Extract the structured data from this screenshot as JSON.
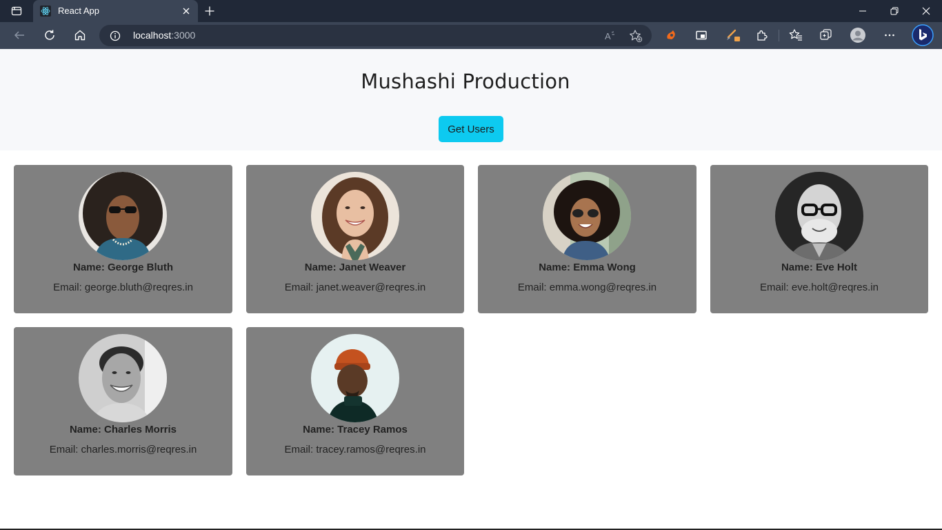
{
  "browser": {
    "tab_title": "React App",
    "address_host": "localhost",
    "address_port": ":3000",
    "accent": "#0dcaf0"
  },
  "icons": {
    "tabs_menu": "tab-actions-icon",
    "favicon": "react-logo-icon",
    "close_tab": "close-icon",
    "new_tab": "plus-icon",
    "minimize": "minimize-icon",
    "restore": "restore-icon",
    "close_window": "close-icon",
    "back": "back-arrow-icon",
    "refresh": "refresh-icon",
    "home": "home-icon",
    "site_info": "info-icon",
    "read_aloud": "read-aloud-icon",
    "add_favorite": "add-favorite-icon",
    "extension_1": "extension-orange-icon",
    "screen_cast": "screen-icon",
    "brush": "paint-brush-icon",
    "extensions": "puzzle-icon",
    "favorites": "favorites-icon",
    "collections": "collections-icon",
    "profile": "profile-avatar-icon",
    "more": "more-icon",
    "copilot": "bing-icon"
  },
  "page": {
    "title": "Mushashi Production",
    "get_users_label": "Get Users"
  },
  "users": [
    {
      "name": "Name: George Bluth",
      "email": "Email: george.bluth@reqres.in"
    },
    {
      "name": "Name: Janet Weaver",
      "email": "Email: janet.weaver@reqres.in"
    },
    {
      "name": "Name: Emma Wong",
      "email": "Email: emma.wong@reqres.in"
    },
    {
      "name": "Name: Eve Holt",
      "email": "Email: eve.holt@reqres.in"
    },
    {
      "name": "Name: Charles Morris",
      "email": "Email: charles.morris@reqres.in"
    },
    {
      "name": "Name: Tracey Ramos",
      "email": "Email: tracey.ramos@reqres.in"
    }
  ]
}
